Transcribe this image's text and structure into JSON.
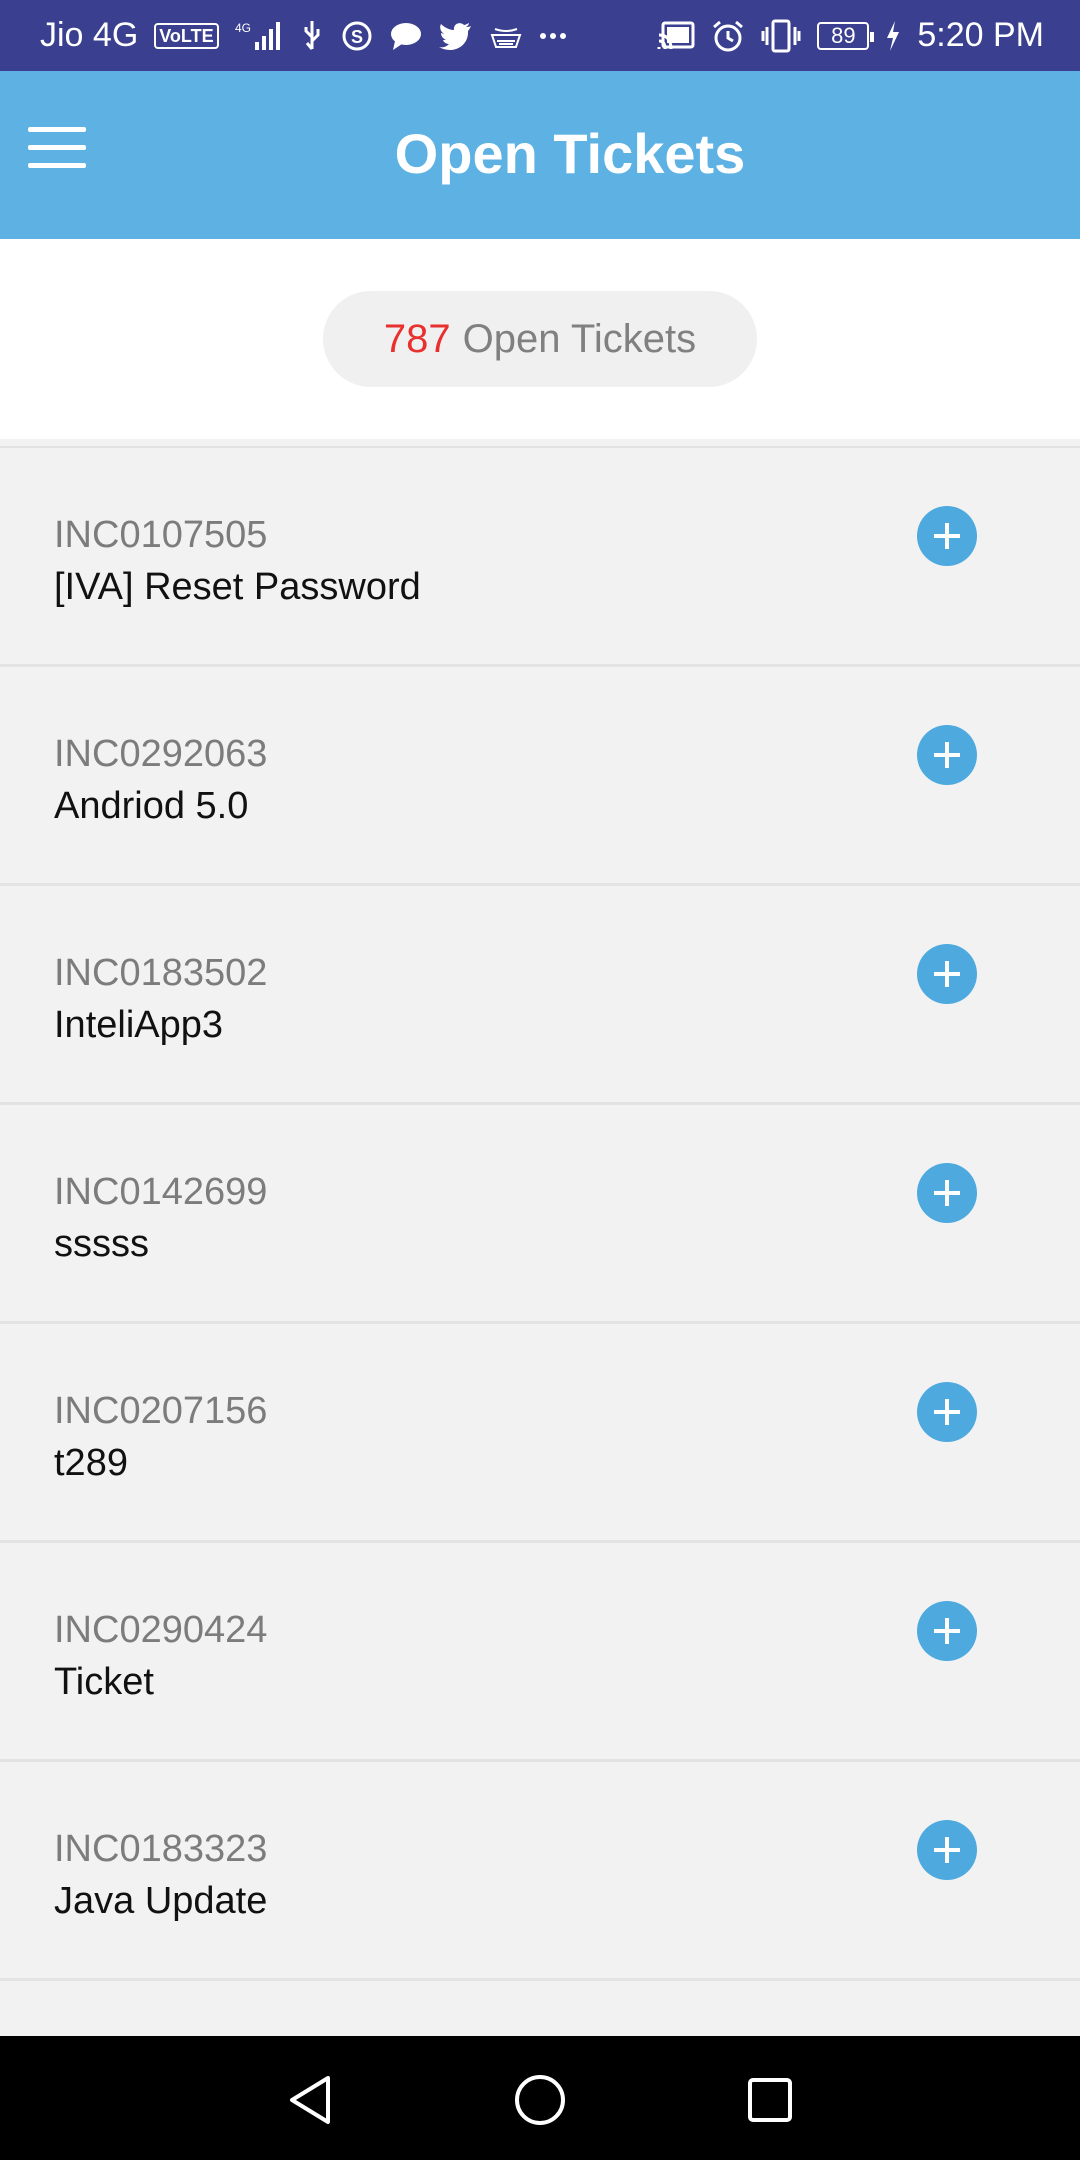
{
  "status_bar": {
    "carrier": "Jio 4G",
    "volte_badge": "VoLTE",
    "network_badge": "4G",
    "battery": "89",
    "time": "5:20 PM"
  },
  "app_bar": {
    "title": "Open Tickets"
  },
  "summary": {
    "count": "787",
    "label": "Open Tickets"
  },
  "tickets": [
    {
      "id": "INC0107505",
      "title": "[IVA] Reset Password"
    },
    {
      "id": "INC0292063",
      "title": "Andriod 5.0"
    },
    {
      "id": "INC0183502",
      "title": "InteliApp3"
    },
    {
      "id": "INC0142699",
      "title": "sssss"
    },
    {
      "id": "INC0207156",
      "title": "t289"
    },
    {
      "id": "INC0290424",
      "title": "Ticket"
    },
    {
      "id": "INC0183323",
      "title": "Java Update"
    },
    {
      "id": "",
      "title": ""
    }
  ],
  "colors": {
    "status_bar": "#3a3f8f",
    "app_bar": "#5db1e3",
    "accent_count": "#e8312e",
    "add_button": "#4ea9df"
  }
}
